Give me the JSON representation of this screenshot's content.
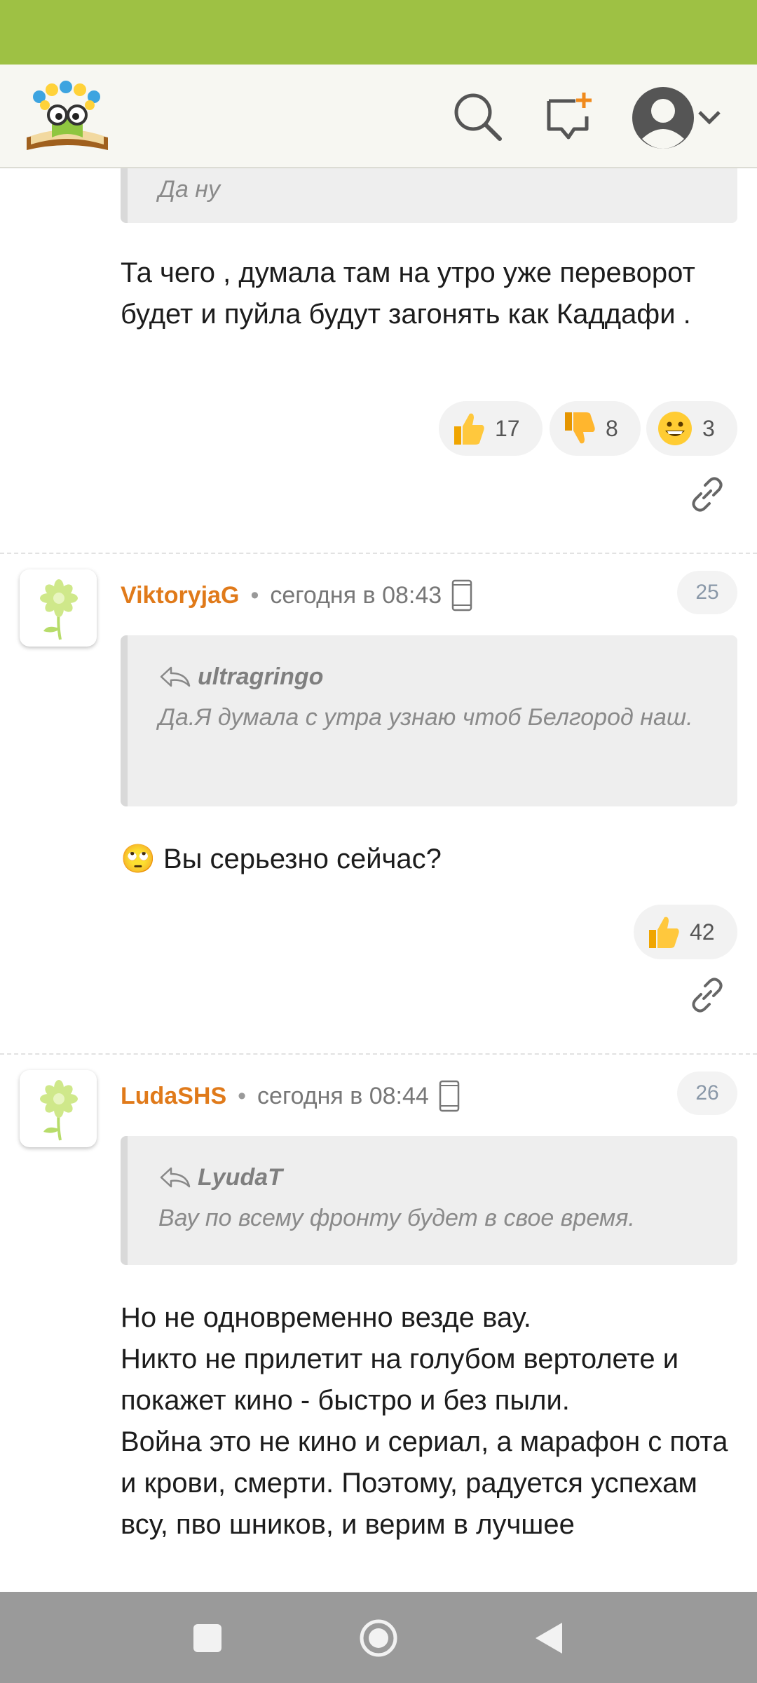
{
  "header": {
    "logo_name": "site-logo",
    "icons": [
      "search-icon",
      "new-post-icon",
      "avatar-icon",
      "chevron-down-icon"
    ]
  },
  "top_comment": {
    "quote_tail": "Да ну",
    "text": "Та чего , думала там на утро уже переворот будет и пуйла будут загонять как Каддафи .",
    "reactions": [
      {
        "icon": "thumbs-up-icon",
        "count": "17"
      },
      {
        "icon": "thumbs-down-icon",
        "count": "8"
      },
      {
        "icon": "grin-icon",
        "count": "3"
      }
    ]
  },
  "comment_25": {
    "username": "ViktoryjaG",
    "time": "сегодня в 08:43",
    "number": "25",
    "quote_author": "ultragringo",
    "quote_text": "Да.Я думала с утра узнаю чтоб Белгород наш.",
    "emoji": "🙄",
    "text": "Вы серьезно сейчас?",
    "reactions": [
      {
        "icon": "thumbs-up-icon",
        "count": "42"
      }
    ]
  },
  "comment_26": {
    "username": "LudaSHS",
    "time": "сегодня в 08:44",
    "number": "26",
    "quote_author": "LyudaT",
    "quote_text": "Вау по всему фронту будет в свое время.",
    "text_lines": [
      "Но не одновременно везде вау.",
      "Никто не прилетит на голубом вертолете и покажет кино - быстро и без пыли.",
      "Война это не кино и сериал, а марафон с пота и крови, смерти. Поэтому, радуется успехам всу, пво шников, и верим в лучшее"
    ]
  },
  "nav": {
    "buttons": [
      "recents-button",
      "home-button",
      "back-button"
    ]
  },
  "colors": {
    "status_bar": "#9ec144",
    "username": "#e07a1a",
    "badge_text": "#8a98a8"
  }
}
